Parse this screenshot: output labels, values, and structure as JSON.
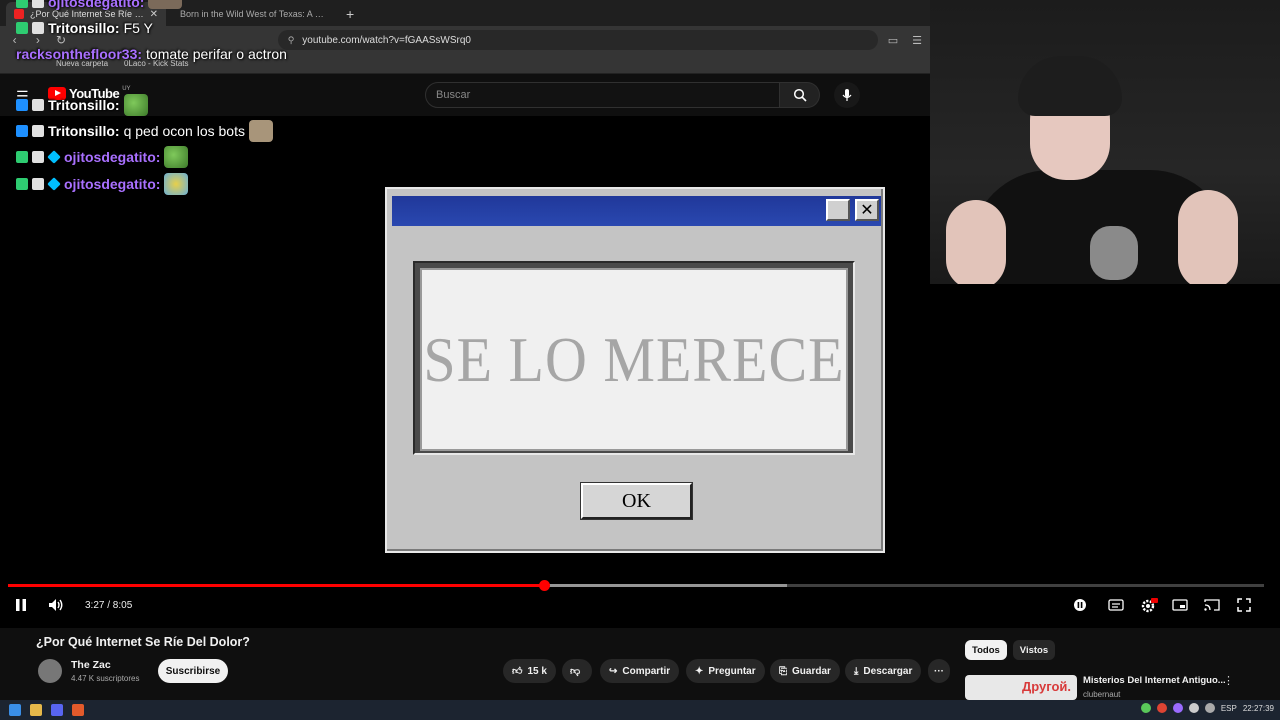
{
  "browser": {
    "tabs": [
      {
        "title": "¿Por Qué Internet Se Ríe Del",
        "active": true
      },
      {
        "title": "Born in the Wild West of Texas: A Jou",
        "active": false
      }
    ],
    "new_tab": "+",
    "url": "youtube.com/watch?v=fGAASsWSrq0",
    "bookmarks": [
      "Nueva carpeta",
      "0Laco - Kick Stats"
    ]
  },
  "youtube": {
    "logo_text": "YouTube",
    "region": "UY",
    "search_placeholder": "Buscar"
  },
  "chat": [
    {
      "user": "ojitosdegatito:",
      "message": "",
      "color": "purple"
    },
    {
      "user": "Tritonsillo:",
      "message": "F5  Y",
      "color": "white"
    },
    {
      "user": "racksonthefloor33:",
      "message": "tomate perifar o actron",
      "color": "purple"
    },
    {
      "user": "Tritonsillo:",
      "message": "",
      "color": "white"
    },
    {
      "user": "Tritonsillo:",
      "message": "q ped ocon los bots",
      "color": "white"
    },
    {
      "user": "ojitosdegatito:",
      "message": "",
      "color": "purple"
    },
    {
      "user": "ojitosdegatito:",
      "message": "",
      "color": "purple"
    }
  ],
  "dialog": {
    "message": "SE LO MERECE",
    "ok_label": "OK",
    "close_glyph": "✕"
  },
  "player": {
    "time": "3:27 / 8:05",
    "progress": 0.427,
    "buffered": 0.62
  },
  "video": {
    "title": "¿Por Qué Internet Se Ríe Del Dolor?",
    "channel": "The Zac",
    "subscribers": "4.47 K suscriptores",
    "subscribe_label": "Suscribirse",
    "likes": "15 k",
    "share_label": "Compartir",
    "ask_label": "Preguntar",
    "save_label": "Guardar",
    "download_label": "Descargar",
    "more_label": "···"
  },
  "sidebar": {
    "chips": [
      "Todos",
      "Vistos"
    ],
    "recommended": {
      "thumb_text": "Другой.",
      "title": "Misterios Del Internet Antiguo...",
      "channel": "clubernaut",
      "more": "⋮"
    }
  },
  "taskbar": {
    "lang": "ESP",
    "clock": "22:27:39"
  },
  "colors": {
    "accent": "#ff0000",
    "dialog_title": "#2a48b0",
    "chat_purple": "#a970ff"
  }
}
